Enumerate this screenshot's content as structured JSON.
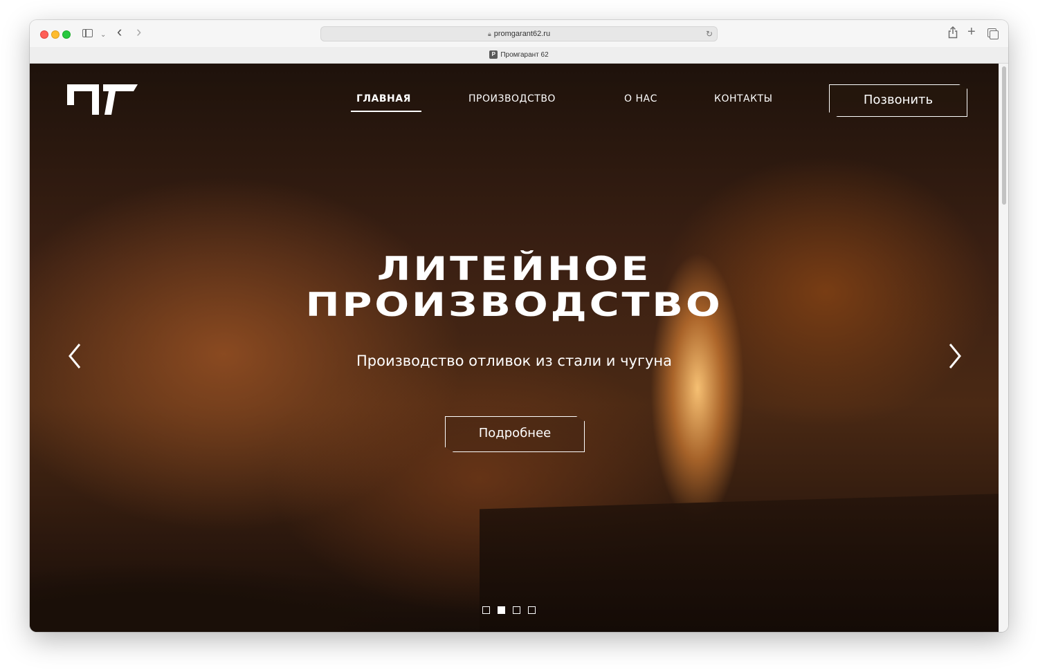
{
  "browser": {
    "url": "promgarant62.ru",
    "tab_title": "Промгарант 62",
    "favicon_letter": "P"
  },
  "site": {
    "logo_text": "ПГ",
    "nav": [
      {
        "label": "ГЛАВНАЯ",
        "active": true
      },
      {
        "label": "ПРОИЗВОДСТВО",
        "active": false
      },
      {
        "label": "О НАС",
        "active": false
      },
      {
        "label": "КОНТАКТЫ",
        "active": false
      }
    ],
    "call_button": "Позвонить"
  },
  "hero": {
    "title_line1": "ЛИТЕЙНОЕ",
    "title_line2": "ПРОИЗВОДСТВО",
    "subtitle": "Производство отливок из стали и чугуна",
    "cta_button": "Подробнее",
    "slides_total": 4,
    "active_slide": 2
  },
  "icons": {
    "back": "chevron-left-icon",
    "forward": "chevron-right-icon",
    "prev_slide": "arrow-left-icon",
    "next_slide": "arrow-right-icon"
  },
  "colors": {
    "traffic_red": "#fe5f57",
    "traffic_yellow": "#febc2e",
    "traffic_green": "#28c840",
    "hero_accent": "#f5a550"
  }
}
